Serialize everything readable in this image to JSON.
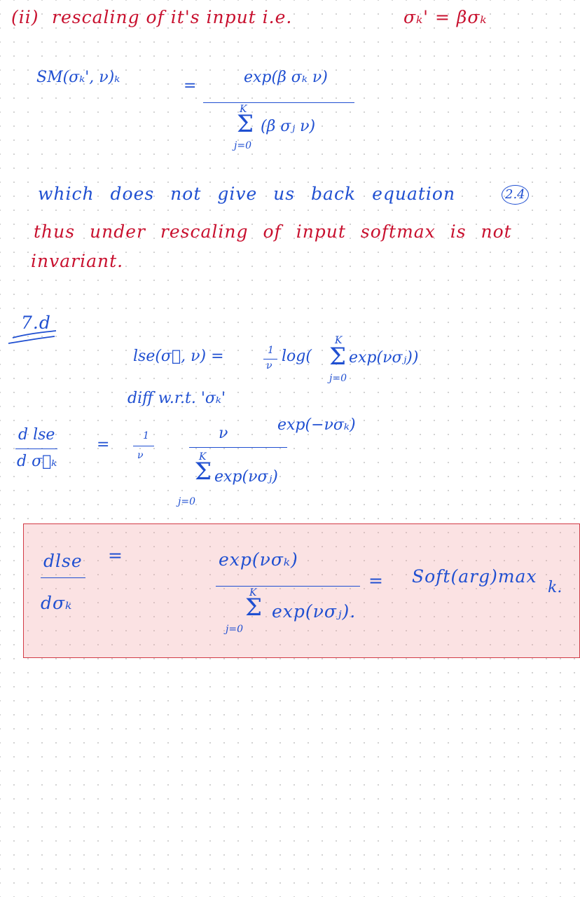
{
  "part_ii": {
    "heading_a": "(ii)",
    "heading_b": "rescaling of it's input i.e.",
    "heading_c": "σₖ' = βσₖ",
    "sm_lhs": "SM(σₖ', ν)ₖ",
    "equals": "=",
    "sm_num": "exp(β σₖ ν)",
    "sm_sum_top": "K",
    "sm_sum_bottom": "j=0",
    "sm_den": "(β σⱼ ν)",
    "remark_1a": "which does not give us back equation",
    "remark_ref": "2.4",
    "remark_2": "thus under rescaling of input softmax is not",
    "remark_3": "invariant."
  },
  "part_7d": {
    "label": "7.d",
    "lse_lhs": "lse(σ⃗, ν) =",
    "frac_one": "1",
    "frac_nu": "ν",
    "log_open": "log(",
    "sum_top": "K",
    "sum_bottom": "j=0",
    "lse_body": "exp(νσⱼ))",
    "diff_text": "diff w.r.t. 'σₖ'",
    "deriv_num": "d lse",
    "deriv_den": "d σ⃗ₖ",
    "eq": "=",
    "coef_1": "1",
    "coef_nu": "ν",
    "num_nu": "ν",
    "num_exp": "exp(−νσₖ)",
    "den_sum_top": "K",
    "den_sum_bottom": "j=0",
    "den_body": "exp(νσⱼ)"
  },
  "boxed": {
    "lhs_num": "dlse",
    "lhs_den": "dσₖ",
    "eq1": "=",
    "num": "exp(νσₖ)",
    "sum_top": "K",
    "sum_bottom": "j=0",
    "den": "exp(νσⱼ).",
    "eq2": "=",
    "rhs": "Soft(arg)max",
    "rhs_sub": "k."
  },
  "colors": {
    "red_ink": "#c8102e",
    "blue_ink": "#1f4fd1",
    "box_fill": "#f6d6d8",
    "box_border": "#d23a45",
    "grid_dot": "#cfcfcf"
  }
}
